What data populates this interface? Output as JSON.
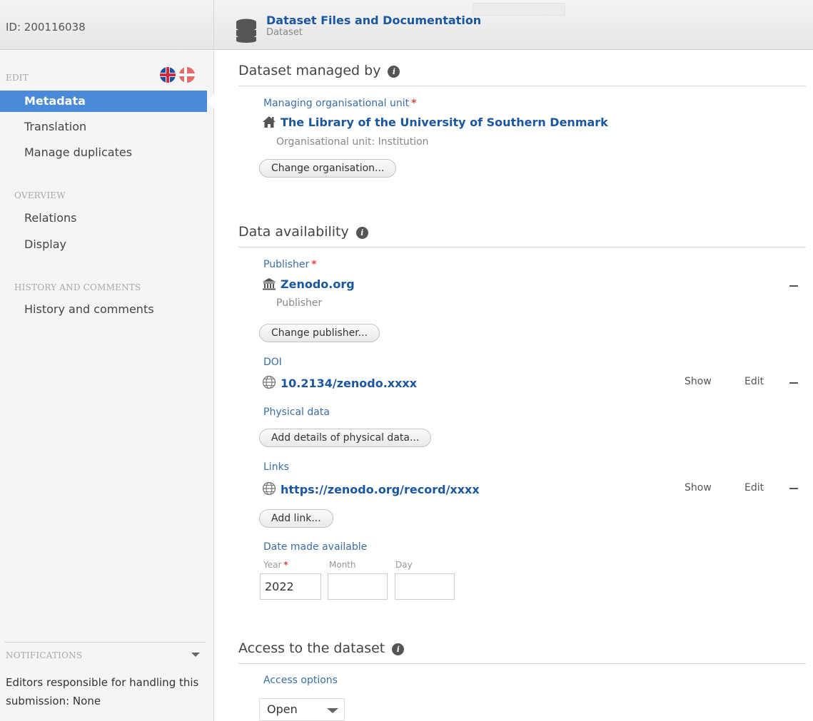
{
  "header": {
    "id_label": "ID: 200116038",
    "title": "Dataset Files and Documentation",
    "subtitle": "Dataset"
  },
  "sidebar": {
    "edit_heading": "EDIT",
    "edit_items": [
      "Metadata",
      "Translation",
      "Manage duplicates"
    ],
    "active_item": "Metadata",
    "overview_heading": "OVERVIEW",
    "overview_items": [
      "Relations",
      "Display"
    ],
    "history_heading": "HISTORY AND COMMENTS",
    "history_items": [
      "History and comments"
    ],
    "notifications_heading": "NOTIFICATIONS",
    "notifications_text": "Editors responsible for handling this submission: None",
    "flags": [
      "uk-flag-icon",
      "denmark-flag-icon"
    ]
  },
  "managed_by": {
    "heading": "Dataset managed by",
    "field_label": "Managing organisational unit",
    "required_mark": "*",
    "unit_name": "The Library of the University of Southern Denmark",
    "unit_type": "Organisational unit: Institution",
    "change_button": "Change organisation..."
  },
  "availability": {
    "heading": "Data availability",
    "publisher_label": "Publisher",
    "required_mark": "*",
    "publisher_name": "Zenodo.org",
    "publisher_type": "Publisher",
    "change_publisher_button": "Change publisher...",
    "doi_label": "DOI",
    "doi_value": "10.2134/zenodo.xxxx",
    "show_label": "Show",
    "edit_label": "Edit",
    "physical_label": "Physical data",
    "physical_button": "Add details of physical data...",
    "links_label": "Links",
    "link_value": "https://zenodo.org/record/xxxx",
    "add_link_button": "Add link...",
    "date_label": "Date made available",
    "year_label": "Year",
    "month_label": "Month",
    "day_label": "Day",
    "year_value": "2022",
    "month_value": "",
    "day_value": ""
  },
  "access": {
    "heading": "Access to the dataset",
    "options_label": "Access options",
    "selected_option": "Open"
  },
  "colors": {
    "accent": "#4a8ad8",
    "link": "#1a57a0",
    "required": "#e0463c"
  }
}
